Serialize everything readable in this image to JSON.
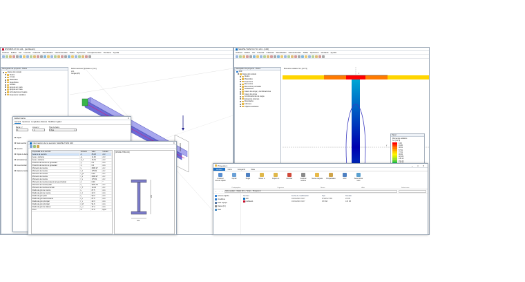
{
  "left_window": {
    "title": "RSTAB 8.27.01 x64 - [profiltest1]",
    "menu": [
      "Archivo",
      "Editar",
      "Ver",
      "Insertar",
      "Calcular",
      "Resultados",
      "Herramientas",
      "Tabla",
      "Opciones",
      "Complementos",
      "Ventana",
      "Ayuda"
    ],
    "navigator_title": "Navegador de proyecto - Datos",
    "tree": [
      "Datos del modelo",
      "Nudos",
      "Líneas",
      "Materiales",
      "Superficies",
      "Sólidos",
      "Apoyos en nudo",
      "Apoyos en línea",
      "Articulaciones lineales",
      "Espesores variables"
    ],
    "viewport_title": "Deformaciones globales u [mm]",
    "viewport_sub": [
      "LC1",
      "Cargas [kN]"
    ]
  },
  "right_window": {
    "title": "SHAPE-THIN 8.27.01 x64 - [100]",
    "menu": [
      "Archivo",
      "Editar",
      "Ver",
      "Insertar",
      "Calcular",
      "Resultados",
      "Herramientas",
      "Tabla",
      "Opciones",
      "Ventana",
      "Ayuda"
    ],
    "navigator_title": "Navegador de proyecto - Datos",
    "tree_root": "100",
    "tree": [
      "Datos del modelo",
      "Nudos",
      "Materiales",
      "Espesores",
      "Elementos",
      "Elementos puntuales",
      "Soldaduras",
      "Casos de carga y combinaciones",
      "Casos de carga",
      "Combinaciones de carga",
      "Esfuerzos internos",
      "Resultados",
      "Informes",
      "Objetos auxiliares"
    ],
    "viewport_title": "Momento estático S-z [cm^3]",
    "legend": {
      "title": "Panel",
      "subtitle": "Momentos estáticos",
      "unit": "S-z [cm^3]",
      "values": [
        "0.00",
        "19.30",
        "38.61",
        "57.91",
        "77.21",
        "96.52",
        "115.82",
        "135.12",
        "154.43",
        "173.73",
        "193.03",
        "212.34",
        "231.64",
        "250.94",
        "270.25",
        "289.55"
      ],
      "colors": [
        "#ff0000",
        "#ff3a00",
        "#ff7a00",
        "#ffa800",
        "#ffd500",
        "#fff200",
        "#d8f000",
        "#9de22a",
        "#50cf3c",
        "#00c060",
        "#00b89e",
        "#00a7d4",
        "#0080e6",
        "#0050d8",
        "#0026c8",
        "#0000b0"
      ],
      "max_label": "Máx :",
      "max_val": "0.00",
      "min_label": "Mín :",
      "min_val": "-289.55"
    }
  },
  "bar_dialog": {
    "title": "Editar barra",
    "tabs": [
      "General",
      "Opciones",
      "Longitudes eficaces",
      "Modificar rígidez"
    ],
    "bar_no_label": "Barra n.º",
    "bar_no": "1",
    "line_no_label": "Línea n.º",
    "line_no": "1",
    "type_label": "Tipo de barra",
    "type_value": "Viga",
    "start_label": "Sección",
    "items": [
      "Rígido",
      "Nudo auxiliar",
      "Sección",
      "Rígido de barra",
      "Articulaciones",
      "Excentricidad",
      "Datos de barra"
    ]
  },
  "section_dialog": {
    "title": "Información de la sección SHAPE-THIN 100",
    "headers": [
      "Propiedad de la sección",
      "Símbolo",
      "Valor",
      "Unidad"
    ],
    "rows": [
      [
        "Área de la sección",
        "A",
        "35.18",
        "cm²"
      ],
      [
        "Área a cortante",
        "Aᵧ",
        "11.46",
        "cm²"
      ],
      [
        "Área a cortante",
        "A_z",
        "16.91",
        "cm²"
      ],
      [
        "Posición del centro de gravedad",
        "yₛ",
        "0.0",
        "mm"
      ],
      [
        "Posición del centro de gravedad",
        "zₛ",
        "0.0",
        "mm"
      ],
      [
        "Momento de inercia",
        "Iᵧ",
        "2695.27",
        "cm⁴"
      ],
      [
        "Momento de inercia",
        "I_z",
        "175.51",
        "cm⁴"
      ],
      [
        "Momento de inercia",
        "I_yz",
        "0.00",
        "cm⁴"
      ],
      [
        "Momento de inercia",
        "I_u",
        "2695.27",
        "cm⁴"
      ],
      [
        "Momento de inercia",
        "I_v",
        "175.51",
        "cm⁴"
      ],
      [
        "Momento de inercia respecto al eje principal",
        "α",
        "0.00",
        "°"
      ],
      [
        "Momento de inercia polar",
        "Iₚ",
        "2870.78",
        "cm⁴"
      ],
      [
        "Momento de inercia a torsión",
        "I_T",
        "10.03",
        "cm⁴"
      ],
      [
        "Radio de giro de inercia",
        "iᵧ",
        "87.5",
        "mm"
      ],
      [
        "Radio de giro de inercia",
        "i_z",
        "22.3",
        "mm"
      ],
      [
        "Radio de giro polar",
        "iₚ",
        "90.3",
        "mm"
      ],
      [
        "Radio de giro determinante",
        "i_u",
        "87.5",
        "mm"
      ],
      [
        "Radio de giro principal",
        "i_v",
        "22.3",
        "mm"
      ],
      [
        "Radio de giro principal",
        "i_M",
        "91.6",
        "mm"
      ],
      [
        "Radio de giro de alabeo",
        "i_ω",
        "47.4",
        "mm"
      ],
      [
        "Peso",
        "G",
        "27.6",
        "kg/m"
      ]
    ],
    "preview_title": "[SHAPE-THIN 100]",
    "dim_h": "200",
    "dim_b": "100"
  },
  "explorer": {
    "title": "Proyecto 1",
    "ribbon_tabs": [
      "Archivo",
      "Inicio",
      "Compartir",
      "Vista"
    ],
    "ribbon_buttons": [
      "Anclar al Acceso rápido",
      "Copiar",
      "Pegar",
      "Mover a",
      "Copiar en",
      "Eliminar",
      "Cambiar nombre",
      "Nueva carpeta",
      "Propiedades",
      "Abrir",
      "Seleccionar todo"
    ],
    "ribbon_small": [
      "Cortar",
      "Copiar ruta de acceso",
      "Pegar acceso directo",
      "Nuevo elemento",
      "Fácil acceso",
      "Editar",
      "Historial",
      "No seleccionar nada",
      "Invertir selección"
    ],
    "ribbon_groups": [
      "Portapapeles",
      "Organizar",
      "Nuevo",
      "Abrir",
      "Seleccionar"
    ],
    "breadcrumb": [
      "Este equipo",
      "Datos (D:)",
      "Temp",
      "Proyecto 1"
    ],
    "sidebar": [
      "Acceso rápido",
      "OneDrive",
      "Este equipo",
      "Datos (D:)",
      "Red"
    ],
    "columns": [
      "Nombre",
      "Fecha de modificación",
      "Tipo",
      "Tamaño"
    ],
    "files": [
      {
        "name": "100",
        "date": "16/01/2020 19:07",
        "type": "SHAPE-THIN",
        "size": "23 KB"
      },
      {
        "name": "profiltest1",
        "date": "16/01/2020 19:07",
        "type": "RSTAB",
        "size": "415 KB"
      }
    ]
  }
}
